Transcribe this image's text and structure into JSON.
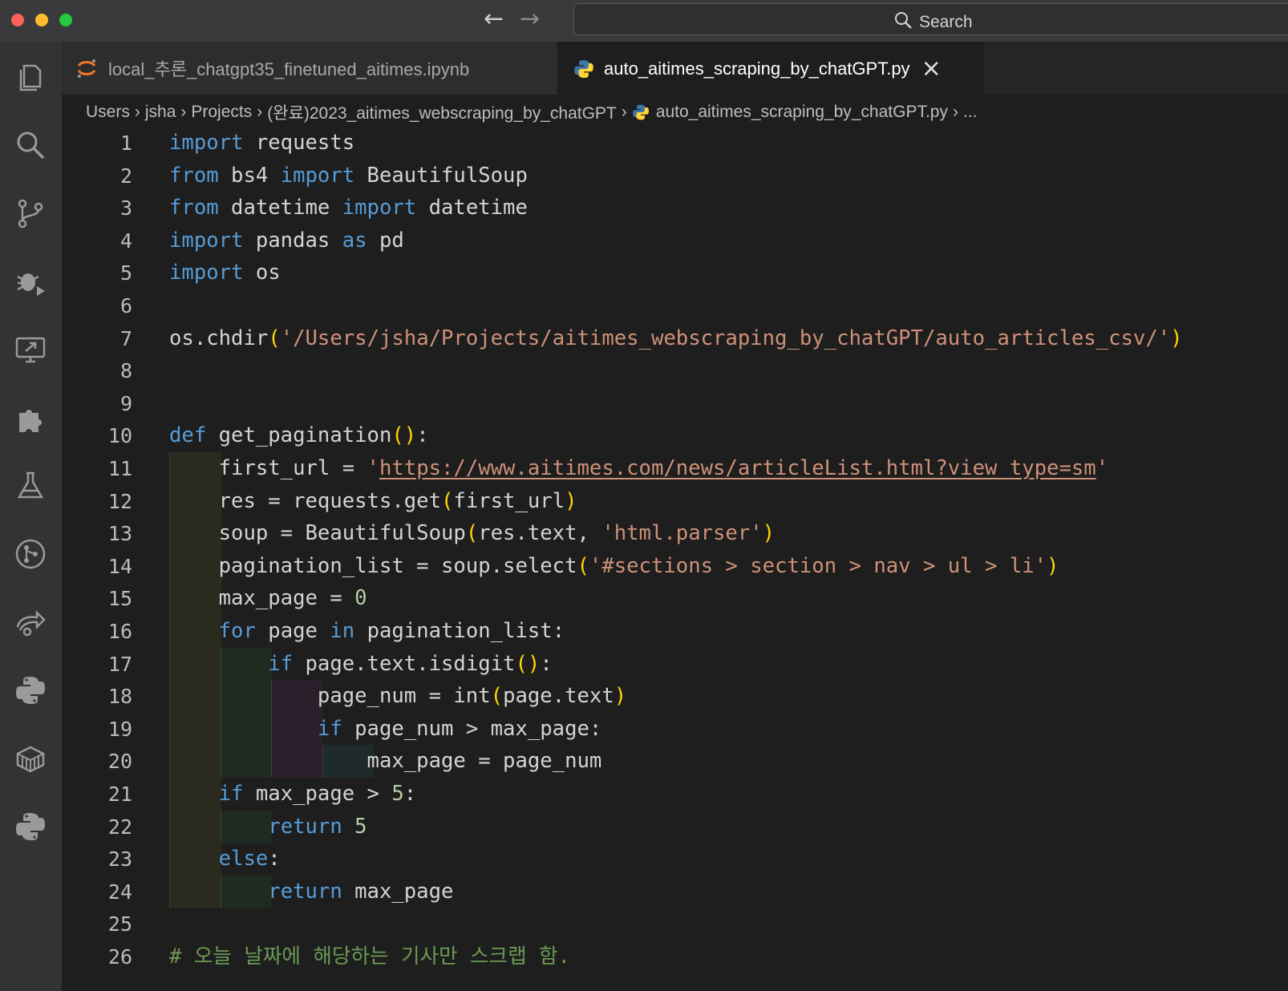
{
  "window": {
    "controls": {
      "close_color": "#fe5f57",
      "minimize_color": "#febc2e",
      "maximize_color": "#28c840"
    },
    "nav": {
      "back": "←",
      "forward": "→"
    },
    "search": {
      "label": "Search"
    }
  },
  "activity_bar": {
    "icons": [
      "explorer-icon",
      "search-icon",
      "source-control-icon",
      "run-debug-icon",
      "remote-explorer-icon",
      "extensions-icon",
      "testing-icon",
      "git-graph-icon",
      "live-share-icon",
      "python-icon",
      "docker-icon",
      "python-env-icon"
    ]
  },
  "tabs": [
    {
      "label": "local_추론_chatgpt35_finetuned_aitimes.ipynb",
      "icon": "jupyter-icon",
      "active": false
    },
    {
      "label": "auto_aitimes_scraping_by_chatGPT.py",
      "icon": "python-file-icon",
      "active": true,
      "close": "×"
    }
  ],
  "breadcrumb": {
    "parts": [
      "Users",
      "jsha",
      "Projects",
      "(완료)2023_aitimes_webscraping_by_chatGPT",
      "auto_aitimes_scraping_by_chatGPT.py",
      "..."
    ],
    "separator": "›"
  },
  "editor": {
    "lines": [
      {
        "n": "1",
        "text": "import requests"
      },
      {
        "n": "2",
        "text": "from bs4 import BeautifulSoup"
      },
      {
        "n": "3",
        "text": "from datetime import datetime"
      },
      {
        "n": "4",
        "text": "import pandas as pd"
      },
      {
        "n": "5",
        "text": "import os"
      },
      {
        "n": "6",
        "text": ""
      },
      {
        "n": "7",
        "text": "os.chdir('/Users/jsha/Projects/aitimes_webscraping_by_chatGPT/auto_articles_csv/')"
      },
      {
        "n": "8",
        "text": ""
      },
      {
        "n": "9",
        "text": ""
      },
      {
        "n": "10",
        "text": "def get_pagination():"
      },
      {
        "n": "11",
        "text": "    first_url = 'https://www.aitimes.com/news/articleList.html?view_type=sm'"
      },
      {
        "n": "12",
        "text": "    res = requests.get(first_url)"
      },
      {
        "n": "13",
        "text": "    soup = BeautifulSoup(res.text, 'html.parser')"
      },
      {
        "n": "14",
        "text": "    pagination_list = soup.select('#sections > section > nav > ul > li')"
      },
      {
        "n": "15",
        "text": "    max_page = 0"
      },
      {
        "n": "16",
        "text": "    for page in pagination_list:"
      },
      {
        "n": "17",
        "text": "        if page.text.isdigit():"
      },
      {
        "n": "18",
        "text": "            page_num = int(page.text)"
      },
      {
        "n": "19",
        "text": "            if page_num > max_page:"
      },
      {
        "n": "20",
        "text": "                max_page = page_num"
      },
      {
        "n": "21",
        "text": "    if max_page > 5:"
      },
      {
        "n": "22",
        "text": "        return 5"
      },
      {
        "n": "23",
        "text": "    else:"
      },
      {
        "n": "24",
        "text": "        return max_page"
      },
      {
        "n": "25",
        "text": ""
      },
      {
        "n": "26",
        "text": "# 오늘 날짜에 해당하는 기사만 스크랩 함."
      }
    ]
  },
  "colors": {
    "keyword": "#569cd6",
    "string": "#ce9178",
    "number": "#b5cea8",
    "bracket": "#ffd700",
    "comment": "#6a9955",
    "text": "#d4d4d4"
  }
}
